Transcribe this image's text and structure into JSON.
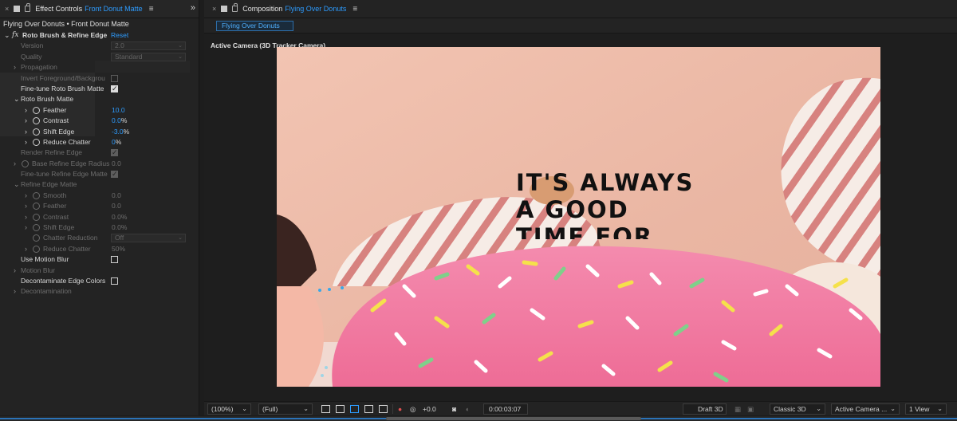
{
  "left_panel": {
    "tab": {
      "close": "×",
      "title": "Effect Controls",
      "subtitle": "Front Donut Matte",
      "menu": "≡"
    },
    "collapse_icon": "»",
    "breadcrumb": "Flying Over Donuts • Front Donut Matte",
    "effect": {
      "name": "Roto Brush & Refine Edge",
      "reset": "Reset",
      "fx": "fx"
    },
    "rows": {
      "version": {
        "label": "Version",
        "value": "2.0"
      },
      "quality": {
        "label": "Quality",
        "value": "Standard"
      },
      "propagation": {
        "label": "Propagation"
      },
      "invert": {
        "label": "Invert Foreground/Backgrou"
      },
      "finetune_roto": {
        "label": "Fine-tune Roto Brush Matte"
      },
      "roto_matte": {
        "label": "Roto Brush Matte"
      },
      "feather": {
        "label": "Feather",
        "value": "10.0"
      },
      "contrast": {
        "label": "Contrast",
        "value": "0.0",
        "unit": "%"
      },
      "shift_edge": {
        "label": "Shift Edge",
        "value": "-3.0",
        "unit": "%"
      },
      "reduce_chatter": {
        "label": "Reduce Chatter",
        "value": "0",
        "unit": "%"
      },
      "render_refine": {
        "label": "Render Refine Edge"
      },
      "base_radius": {
        "label": "Base Refine Edge Radius",
        "value": "0.0"
      },
      "finetune_refine": {
        "label": "Fine-tune Refine Edge Matte"
      },
      "refine_matte": {
        "label": "Refine Edge Matte"
      },
      "r_smooth": {
        "label": "Smooth",
        "value": "0.0"
      },
      "r_feather": {
        "label": "Feather",
        "value": "0.0"
      },
      "r_contrast": {
        "label": "Contrast",
        "value": "0.0%"
      },
      "r_shift": {
        "label": "Shift Edge",
        "value": "0.0%"
      },
      "r_chatter_red": {
        "label": "Chatter Reduction",
        "value": "Off"
      },
      "r_reduce_chatter": {
        "label": "Reduce Chatter",
        "value": "50%"
      },
      "motion_blur_use": {
        "label": "Use Motion Blur"
      },
      "motion_blur": {
        "label": "Motion Blur"
      },
      "decontam_colors": {
        "label": "Decontaminate Edge Colors"
      },
      "decontamination": {
        "label": "Decontamination"
      }
    }
  },
  "right_panel": {
    "tab": {
      "close": "×",
      "title": "Composition",
      "subtitle": "Flying Over Donuts",
      "menu": "≡"
    },
    "chip": "Flying Over Donuts",
    "camera_label": "Active Camera (3D Tracker Camera)",
    "overlay_text": [
      "IT'S ALWAYS",
      "A GOOD",
      "TIME FOR"
    ],
    "toolbar": {
      "zoom": "(100%)",
      "resolution": "(Full)",
      "exposure": "+0.0",
      "timecode": "0:00:03:07",
      "draft3d": "Draft 3D",
      "renderer": "Classic 3D",
      "camera": "Active Camera ...",
      "views": "1 View"
    }
  },
  "colors": {
    "accent_blue": "#2d9cff",
    "panel_bg": "#232323",
    "frosting_pink": "#f07aa0"
  }
}
